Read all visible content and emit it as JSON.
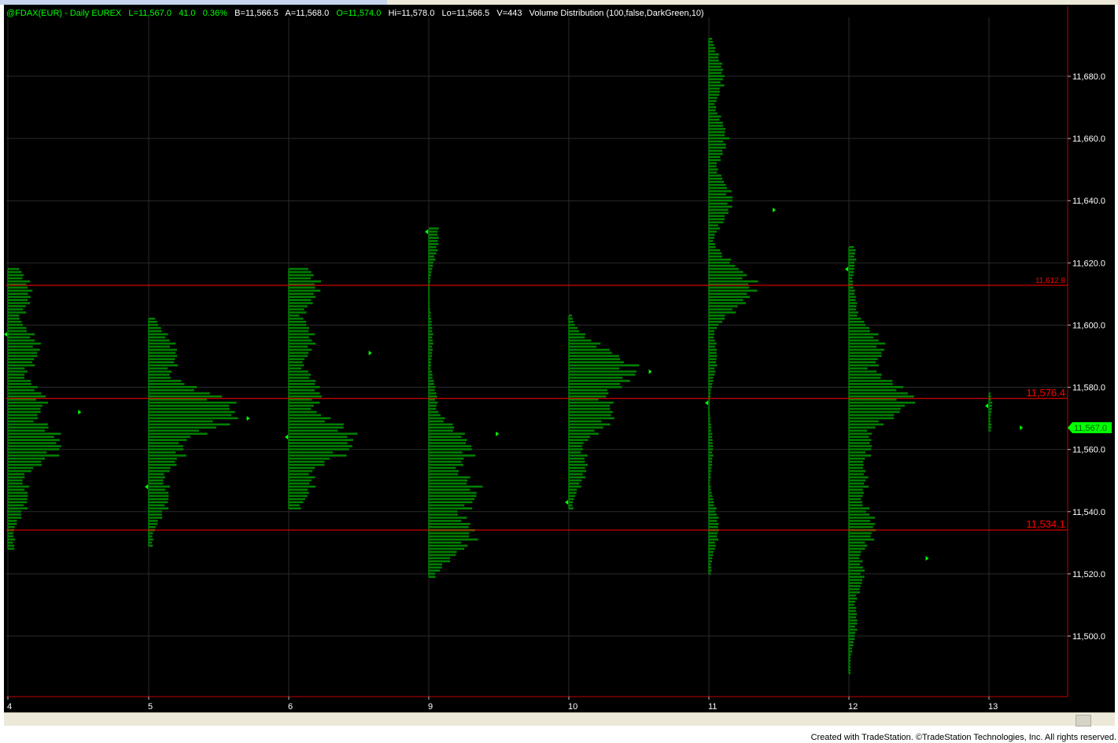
{
  "header": {
    "symbol": "@FDAX(EUR) - Daily  EUREX",
    "last": "L=11,567.0",
    "change": "41.0",
    "change_pct": "0.36%",
    "bid": "B=11,566.5",
    "ask": "A=11,568.0",
    "open": "O=11,574.0",
    "high": "Hi=11,578.0",
    "low": "Lo=11,566.5",
    "volume": "V=443",
    "indicator": "Volume Distribution (100,false,DarkGreen,10)"
  },
  "footer": "Created with TradeStation. ©TradeStation Technologies, Inc. All rights reserved.",
  "colors": {
    "background": "#000000",
    "profile": "#008000",
    "text_green": "#00ff00",
    "level_line": "#ff0000",
    "grid": "#2a2a2a"
  },
  "chart_data": {
    "type": "volume-profile",
    "x_categories": [
      "4",
      "5",
      "6",
      "9",
      "10",
      "11",
      "12",
      "13"
    ],
    "y_range": [
      11485,
      11705
    ],
    "y_ticks": [
      "11,500.0",
      "11,520.0",
      "11,540.0",
      "11,560.0",
      "11,580.0",
      "11,600.0",
      "11,620.0",
      "11,640.0",
      "11,660.0",
      "11,680.0"
    ],
    "y_tick_values": [
      11500,
      11520,
      11540,
      11560,
      11580,
      11600,
      11620,
      11640,
      11660,
      11680
    ],
    "levels": [
      {
        "label": "11,612.8",
        "value": 11612.8,
        "size": "small"
      },
      {
        "label": "11,576.4",
        "value": 11576.4,
        "size": "large"
      },
      {
        "label": "11,534.1",
        "value": 11534.1,
        "size": "large"
      }
    ],
    "last_price": {
      "label": "11,567.0",
      "value": 11567.0
    },
    "sessions": [
      {
        "day": "4",
        "low": 11528,
        "high": 11618,
        "open": 11597,
        "close": 11572,
        "peaks": [
          [
            11530,
            8
          ],
          [
            11545,
            25
          ],
          [
            11562,
            65
          ],
          [
            11575,
            45
          ],
          [
            11592,
            38
          ],
          [
            11610,
            28
          ]
        ]
      },
      {
        "day": "5",
        "low": 11529,
        "high": 11602,
        "open": 11548,
        "close": 11570,
        "peaks": [
          [
            11530,
            5
          ],
          [
            11545,
            25
          ],
          [
            11560,
            42
          ],
          [
            11572,
            108
          ],
          [
            11590,
            35
          ],
          [
            11600,
            6
          ]
        ]
      },
      {
        "day": "6",
        "low": 11541,
        "high": 11618,
        "open": 11564,
        "close": 11591,
        "peaks": [
          [
            11542,
            5
          ],
          [
            11550,
            30
          ],
          [
            11563,
            80
          ],
          [
            11578,
            38
          ],
          [
            11595,
            30
          ],
          [
            11612,
            36
          ]
        ]
      },
      {
        "day": "9",
        "low": 11519,
        "high": 11631,
        "open": 11630,
        "close": 11565,
        "peaks": [
          [
            11521,
            8
          ],
          [
            11533,
            55
          ],
          [
            11546,
            60
          ],
          [
            11560,
            52
          ],
          [
            11575,
            10
          ],
          [
            11595,
            5
          ],
          [
            11628,
            12
          ]
        ]
      },
      {
        "day": "10",
        "low": 11541,
        "high": 11603,
        "open": 11543,
        "close": 11585,
        "peaks": [
          [
            11542,
            5
          ],
          [
            11555,
            22
          ],
          [
            11572,
            55
          ],
          [
            11585,
            80
          ],
          [
            11600,
            5
          ]
        ]
      },
      {
        "day": "11",
        "low": 11520,
        "high": 11692,
        "open": 11575,
        "close": 11637,
        "peaks": [
          [
            11521,
            3
          ],
          [
            11535,
            12
          ],
          [
            11560,
            5
          ],
          [
            11590,
            10
          ],
          [
            11612,
            55
          ],
          [
            11640,
            28
          ],
          [
            11660,
            22
          ],
          [
            11680,
            18
          ],
          [
            11690,
            4
          ]
        ]
      },
      {
        "day": "12",
        "low": 11488,
        "high": 11625,
        "open": 11618,
        "close": 11525,
        "peaks": [
          [
            11490,
            2
          ],
          [
            11505,
            10
          ],
          [
            11520,
            18
          ],
          [
            11535,
            32
          ],
          [
            11550,
            22
          ],
          [
            11562,
            28
          ],
          [
            11576,
            75
          ],
          [
            11592,
            42
          ],
          [
            11605,
            10
          ],
          [
            11622,
            8
          ]
        ]
      },
      {
        "day": "13",
        "low": 11566,
        "high": 11578,
        "open": 11574,
        "close": 11567,
        "peaks": [
          [
            11567,
            3
          ],
          [
            11574,
            4
          ],
          [
            11577,
            2
          ]
        ]
      }
    ]
  }
}
